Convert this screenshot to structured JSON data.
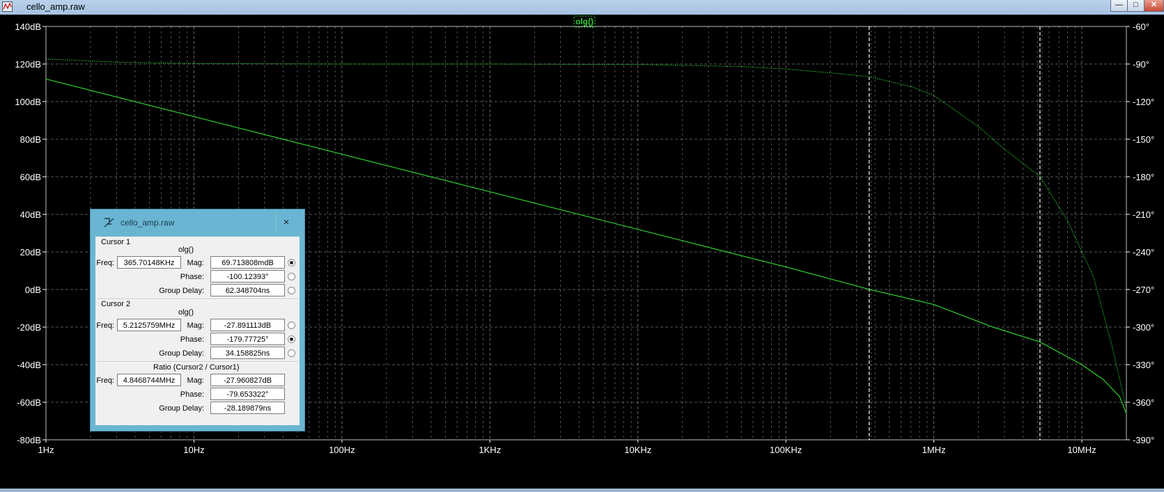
{
  "window": {
    "title": "cello_amp.raw",
    "minimize_label": "—",
    "maximize_label": "□",
    "close_label": "✕"
  },
  "colors": {
    "background": "#000000",
    "grid": "#8a8a8a",
    "trace": "#2fd02f",
    "axis_text": "#ffffff",
    "cursor": "#ffffff"
  },
  "chart_data": {
    "type": "line",
    "trace_label": "olg()",
    "x_scale": "log",
    "x_range": [
      1,
      20000000
    ],
    "x_ticks": [
      {
        "v": 1,
        "label": "1Hz"
      },
      {
        "v": 10,
        "label": "10Hz"
      },
      {
        "v": 100,
        "label": "100Hz"
      },
      {
        "v": 1000,
        "label": "1KHz"
      },
      {
        "v": 10000,
        "label": "10KHz"
      },
      {
        "v": 100000,
        "label": "100KHz"
      },
      {
        "v": 1000000,
        "label": "1MHz"
      },
      {
        "v": 10000000,
        "label": "10MHz"
      }
    ],
    "y_left_range": [
      -80,
      140
    ],
    "y_left_ticks": [
      {
        "v": 140,
        "label": "140dB"
      },
      {
        "v": 120,
        "label": "120dB"
      },
      {
        "v": 100,
        "label": "100dB"
      },
      {
        "v": 80,
        "label": "80dB"
      },
      {
        "v": 60,
        "label": "60dB"
      },
      {
        "v": 40,
        "label": "40dB"
      },
      {
        "v": 20,
        "label": "20dB"
      },
      {
        "v": 0,
        "label": "0dB"
      },
      {
        "v": -20,
        "label": "-20dB"
      },
      {
        "v": -40,
        "label": "-40dB"
      },
      {
        "v": -60,
        "label": "-60dB"
      },
      {
        "v": -80,
        "label": "-80dB"
      }
    ],
    "y_right_range": [
      -390,
      -60
    ],
    "y_right_ticks": [
      {
        "v": -60,
        "label": "-60°"
      },
      {
        "v": -90,
        "label": "-90°"
      },
      {
        "v": -120,
        "label": "-120°"
      },
      {
        "v": -150,
        "label": "-150°"
      },
      {
        "v": -180,
        "label": "-180°"
      },
      {
        "v": -210,
        "label": "-210°"
      },
      {
        "v": -240,
        "label": "-240°"
      },
      {
        "v": -270,
        "label": "-270°"
      },
      {
        "v": -300,
        "label": "-300°"
      },
      {
        "v": -330,
        "label": "-330°"
      },
      {
        "v": -360,
        "label": "-360°"
      },
      {
        "v": -390,
        "label": "-390°"
      }
    ],
    "magnitude": [
      {
        "f": 1,
        "v": 112
      },
      {
        "f": 10,
        "v": 92
      },
      {
        "f": 100,
        "v": 72
      },
      {
        "f": 1000,
        "v": 52
      },
      {
        "f": 10000,
        "v": 32
      },
      {
        "f": 100000,
        "v": 12
      },
      {
        "f": 365701,
        "v": 0.07
      },
      {
        "f": 1000000,
        "v": -8
      },
      {
        "f": 2500000,
        "v": -20
      },
      {
        "f": 5212576,
        "v": -27.9
      },
      {
        "f": 10000000,
        "v": -40
      },
      {
        "f": 14000000,
        "v": -48
      },
      {
        "f": 18000000,
        "v": -57
      },
      {
        "f": 20000000,
        "v": -66
      }
    ],
    "phase": [
      {
        "f": 1,
        "v": -86
      },
      {
        "f": 3,
        "v": -88.5
      },
      {
        "f": 10,
        "v": -89.6
      },
      {
        "f": 100,
        "v": -90
      },
      {
        "f": 1000,
        "v": -90
      },
      {
        "f": 10000,
        "v": -90.4
      },
      {
        "f": 50000,
        "v": -92
      },
      {
        "f": 100000,
        "v": -94
      },
      {
        "f": 200000,
        "v": -97
      },
      {
        "f": 365701,
        "v": -100.12
      },
      {
        "f": 700000,
        "v": -108
      },
      {
        "f": 1000000,
        "v": -115
      },
      {
        "f": 2000000,
        "v": -140
      },
      {
        "f": 3000000,
        "v": -158
      },
      {
        "f": 5212576,
        "v": -179.78
      },
      {
        "f": 8000000,
        "v": -215
      },
      {
        "f": 12000000,
        "v": -260
      },
      {
        "f": 16000000,
        "v": -315
      },
      {
        "f": 20000000,
        "v": -365
      }
    ],
    "cursors": [
      {
        "f": 365701
      },
      {
        "f": 5212576
      }
    ]
  },
  "dialog": {
    "title": "cello_amp.raw",
    "close_label": "×",
    "cursor1": {
      "heading": "Cursor 1",
      "trace": "olg()",
      "freq_label": "Freq:",
      "freq": "365.70148KHz",
      "mag_label": "Mag:",
      "mag": "69.713808mdB",
      "phase_label": "Phase:",
      "phase": "-100.12393°",
      "gd_label": "Group Delay:",
      "gd": "62.348704ns"
    },
    "cursor2": {
      "heading": "Cursor 2",
      "trace": "olg()",
      "freq_label": "Freq:",
      "freq": "5.2125759MHz",
      "mag_label": "Mag:",
      "mag": "-27.891113dB",
      "phase_label": "Phase:",
      "phase": "-179.77725°",
      "gd_label": "Group Delay:",
      "gd": "34.158825ns"
    },
    "ratio": {
      "heading": "Ratio (Cursor2 / Cursor1)",
      "freq_label": "Freq:",
      "freq": "4.8468744MHz",
      "mag_label": "Mag:",
      "mag": "-27.960827dB",
      "phase_label": "Phase:",
      "phase": "-79.653322°",
      "gd_label": "Group Delay:",
      "gd": "-28.189879ns"
    }
  }
}
